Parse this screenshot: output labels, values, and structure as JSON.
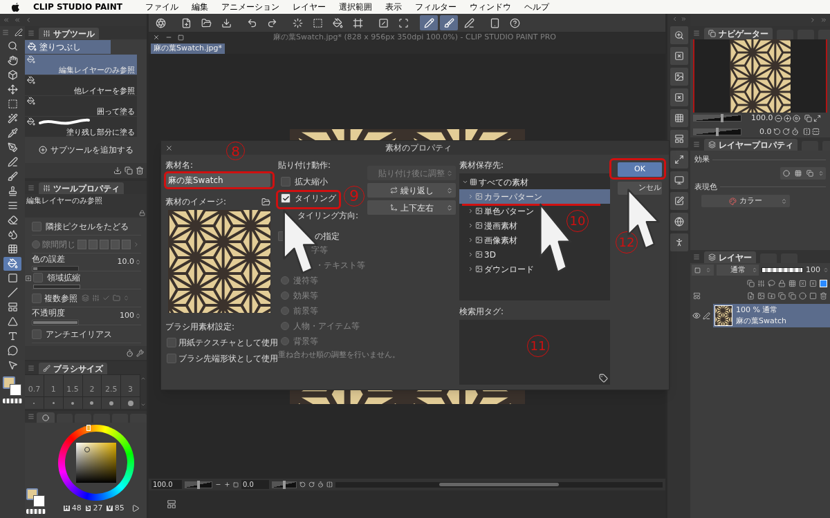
{
  "menubar": {
    "app": "CLIP STUDIO PAINT",
    "items": [
      "ファイル",
      "編集",
      "アニメーション",
      "レイヤー",
      "選択範囲",
      "表示",
      "フィルター",
      "ウィンドウ",
      "ヘルプ"
    ]
  },
  "tools": [
    {
      "selected": false
    },
    {
      "selected": false
    },
    {
      "selected": false
    },
    {
      "selected": false
    },
    {
      "selected": false
    },
    {
      "selected": false
    },
    {
      "selected": false
    },
    {
      "selected": false
    },
    {
      "selected": false
    },
    {
      "selected": false
    },
    {
      "selected": false
    },
    {
      "selected": false
    },
    {
      "selected": false
    },
    {
      "selected": false
    },
    {
      "selected": false
    },
    {
      "selected": true
    },
    {
      "selected": false
    },
    {
      "selected": false
    },
    {
      "selected": false
    },
    {
      "selected": false
    },
    {
      "selected": false
    },
    {
      "selected": false
    },
    {
      "selected": false
    }
  ],
  "toolbar": [
    {
      "selected": false
    },
    {
      "selected": false
    },
    {
      "selected": false
    },
    {
      "selected": false
    },
    {
      "selected": false
    },
    {
      "selected": false
    },
    {
      "selected": false
    },
    {
      "selected": false
    },
    {
      "selected": false
    },
    {
      "selected": false
    },
    {
      "selected": false
    },
    {
      "selected": false
    },
    {
      "selected": true
    },
    {
      "selected": true
    },
    {
      "selected": false
    },
    {
      "selected": false
    },
    {
      "selected": false
    }
  ],
  "document": {
    "title": "麻の葉Swatch.jpg* (828 x 956px 350dpi 100.0%) - CLIP STUDIO PAINT PRO",
    "tab": "麻の葉Swatch.jpg*",
    "zoom": "100.0",
    "zoom_slider": {
      "level": 0.5
    },
    "angle": "0.0",
    "angle_slider": {
      "level": 0.5
    }
  },
  "subtool": {
    "title": "サブツール",
    "group": "塗りつぶし",
    "add": "サブツールを追加する",
    "items": [
      {
        "label": "編集レイヤーのみ参照",
        "selected": true
      },
      {
        "label": "他レイヤーを参照",
        "selected": false
      },
      {
        "label": "囲って塗る",
        "selected": false
      },
      {
        "label": "塗り残し部分に塗る",
        "selected": false
      }
    ]
  },
  "tool_property": {
    "title": "ツールプロパティ",
    "subtool": "編集レイヤーのみ参照",
    "rows": [
      {
        "kind": "checkbox",
        "label": "隣接ピクセルをたどる",
        "checked": false
      },
      {
        "kind": "gap",
        "label": "隙間閉じ"
      },
      {
        "kind": "slider",
        "label": "色の誤差",
        "value": "10.0",
        "level": 0.1
      },
      {
        "kind": "expand",
        "label": "領域拡縮",
        "checked": false
      },
      {
        "kind": "multi",
        "label": "複数参照",
        "checked": false
      },
      {
        "kind": "slider",
        "label": "不透明度",
        "value": "100",
        "level": 1
      },
      {
        "kind": "checkbox",
        "label": "アンチエイリアス",
        "checked": false
      }
    ]
  },
  "brush_size": {
    "title": "ブラシサイズ",
    "sizes": [
      "0.7",
      "1",
      "1.5",
      "2",
      "2.5",
      "3"
    ]
  },
  "color": {
    "hsv": [
      {
        "label": "H",
        "value": "48"
      },
      {
        "label": "S",
        "value": "27"
      },
      {
        "label": "V",
        "value": "85"
      }
    ]
  },
  "dialog": {
    "title": "素材のプロパティ",
    "name_label": "素材名:",
    "name_value": "麻の葉Swatch",
    "image_label": "素材のイメージ:",
    "brush_label": "ブラシ用素材設定:",
    "brush_options": [
      {
        "label": "用紙テクスチャとして使用",
        "checked": false
      },
      {
        "label": "ブラシ先端形状として使用",
        "checked": false
      }
    ],
    "paste_label": "貼り付け動作:",
    "scale": {
      "label": "拡大縮小",
      "checked": false,
      "mode": "貼り付け後に調整"
    },
    "tiling": {
      "label": "タイリング",
      "checked": true,
      "mode": "繰り返し",
      "direction_label": "タイリング方向:",
      "direction": "上下左右"
    },
    "layer_order": {
      "label": "の指定",
      "checked": false,
      "options": [
        "字等",
        "・テキスト等",
        "漫符等",
        "効果等",
        "前景等",
        "人物・アイテム等",
        "背景等"
      ],
      "note": "重ね合わせ順の調整を行いません。"
    },
    "save_label": "素材保存先:",
    "tree": [
      {
        "label": "すべての素材",
        "selected": false,
        "expanded": true,
        "children": [
          {
            "label": "カラーパターン",
            "selected": true,
            "expanded": false
          },
          {
            "label": "単色パターン",
            "selected": false,
            "expanded": false
          },
          {
            "label": "漫画素材",
            "selected": false,
            "expanded": false
          },
          {
            "label": "画像素材",
            "selected": false,
            "expanded": false
          },
          {
            "label": "3D",
            "selected": false,
            "expanded": false
          },
          {
            "label": "ダウンロード",
            "selected": false,
            "expanded": false
          }
        ]
      }
    ],
    "tag_label": "検索用タグ:",
    "ok": "OK",
    "cancel": "ンセル"
  },
  "callouts": [
    "8",
    "9",
    "10",
    "11",
    "12"
  ],
  "navigator": {
    "title": "ナビゲーター",
    "zoom": "100.0",
    "zoom_slider": {
      "level": 0.6
    },
    "angle": "0.0",
    "angle_slider": {
      "level": 0.5
    }
  },
  "layer_property": {
    "title": "レイヤープロパティ",
    "effect_label": "効果",
    "color_label": "表現色",
    "color_mode": "カラー"
  },
  "layers": {
    "title": "レイヤー",
    "blend": "通常",
    "opacity": "100",
    "level": 1,
    "items": [
      {
        "info": "100 % 通常",
        "name": "麻の葉Swatch",
        "selected": true
      }
    ]
  }
}
